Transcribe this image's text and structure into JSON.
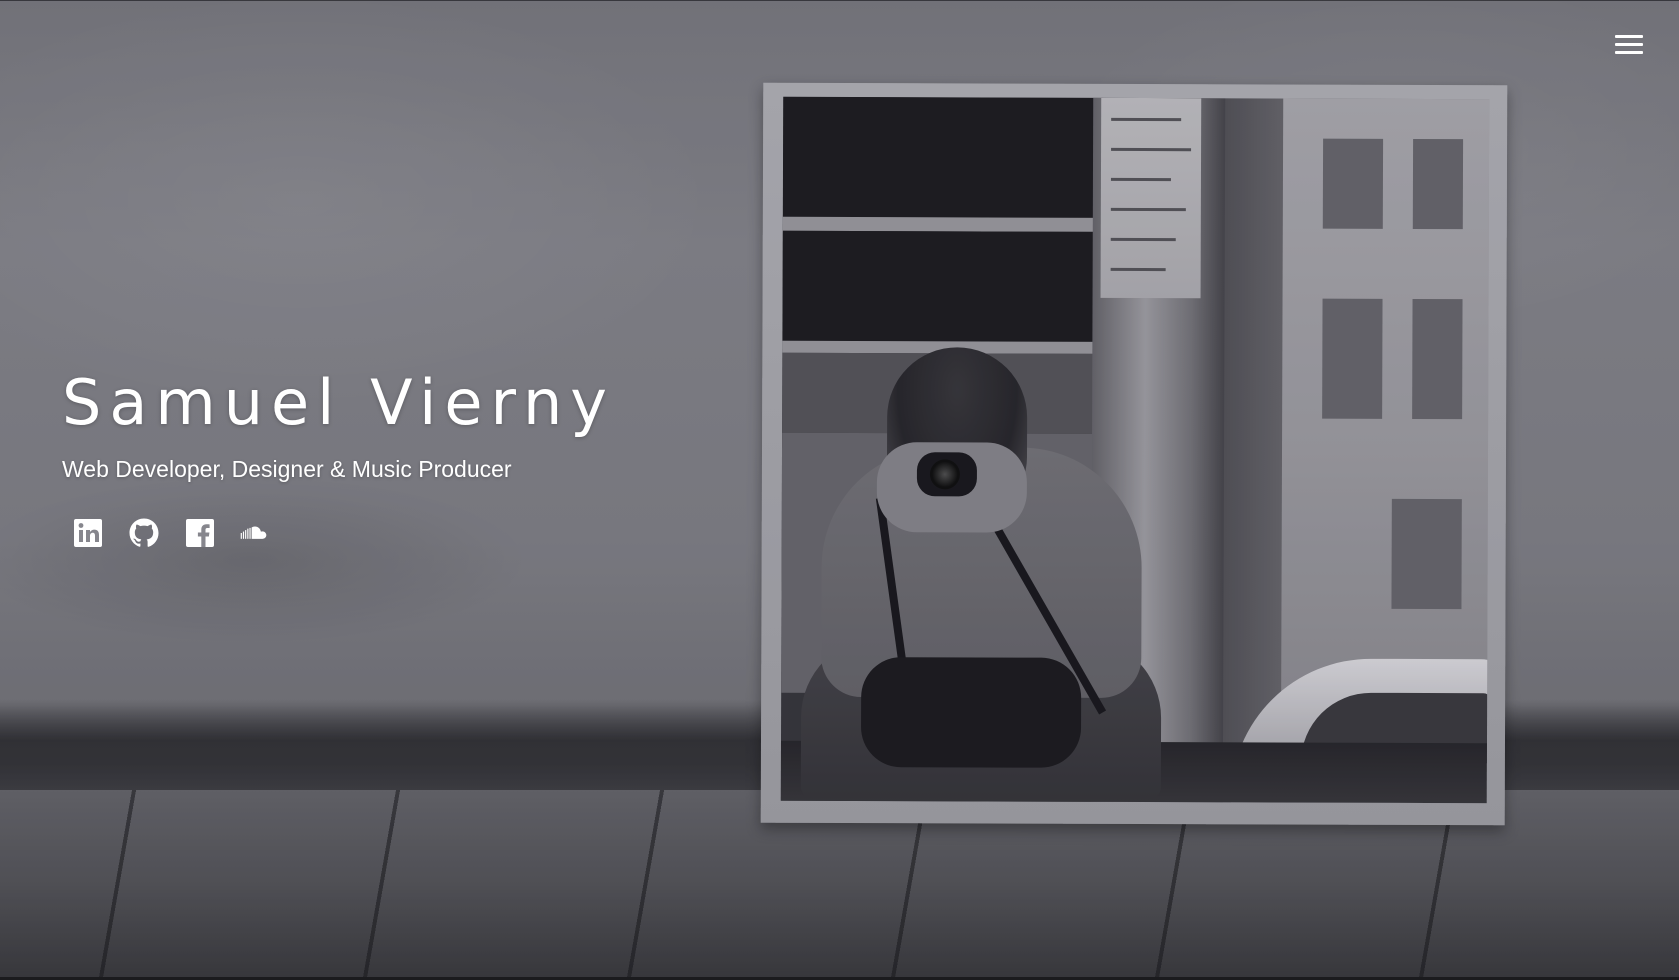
{
  "header": {
    "menu_icon": "hamburger-menu-icon"
  },
  "hero": {
    "name": "Samuel Vierny",
    "tagline": "Web Developer, Designer & Music Producer",
    "background_image": "photo-mirror-selfie-street",
    "socials": [
      {
        "name": "LinkedIn",
        "icon": "linkedin-icon"
      },
      {
        "name": "GitHub",
        "icon": "github-icon"
      },
      {
        "name": "Facebook",
        "icon": "facebook-icon"
      },
      {
        "name": "SoundCloud",
        "icon": "soundcloud-icon"
      }
    ]
  },
  "colors": {
    "text": "#ffffff",
    "background": "#86868d"
  }
}
